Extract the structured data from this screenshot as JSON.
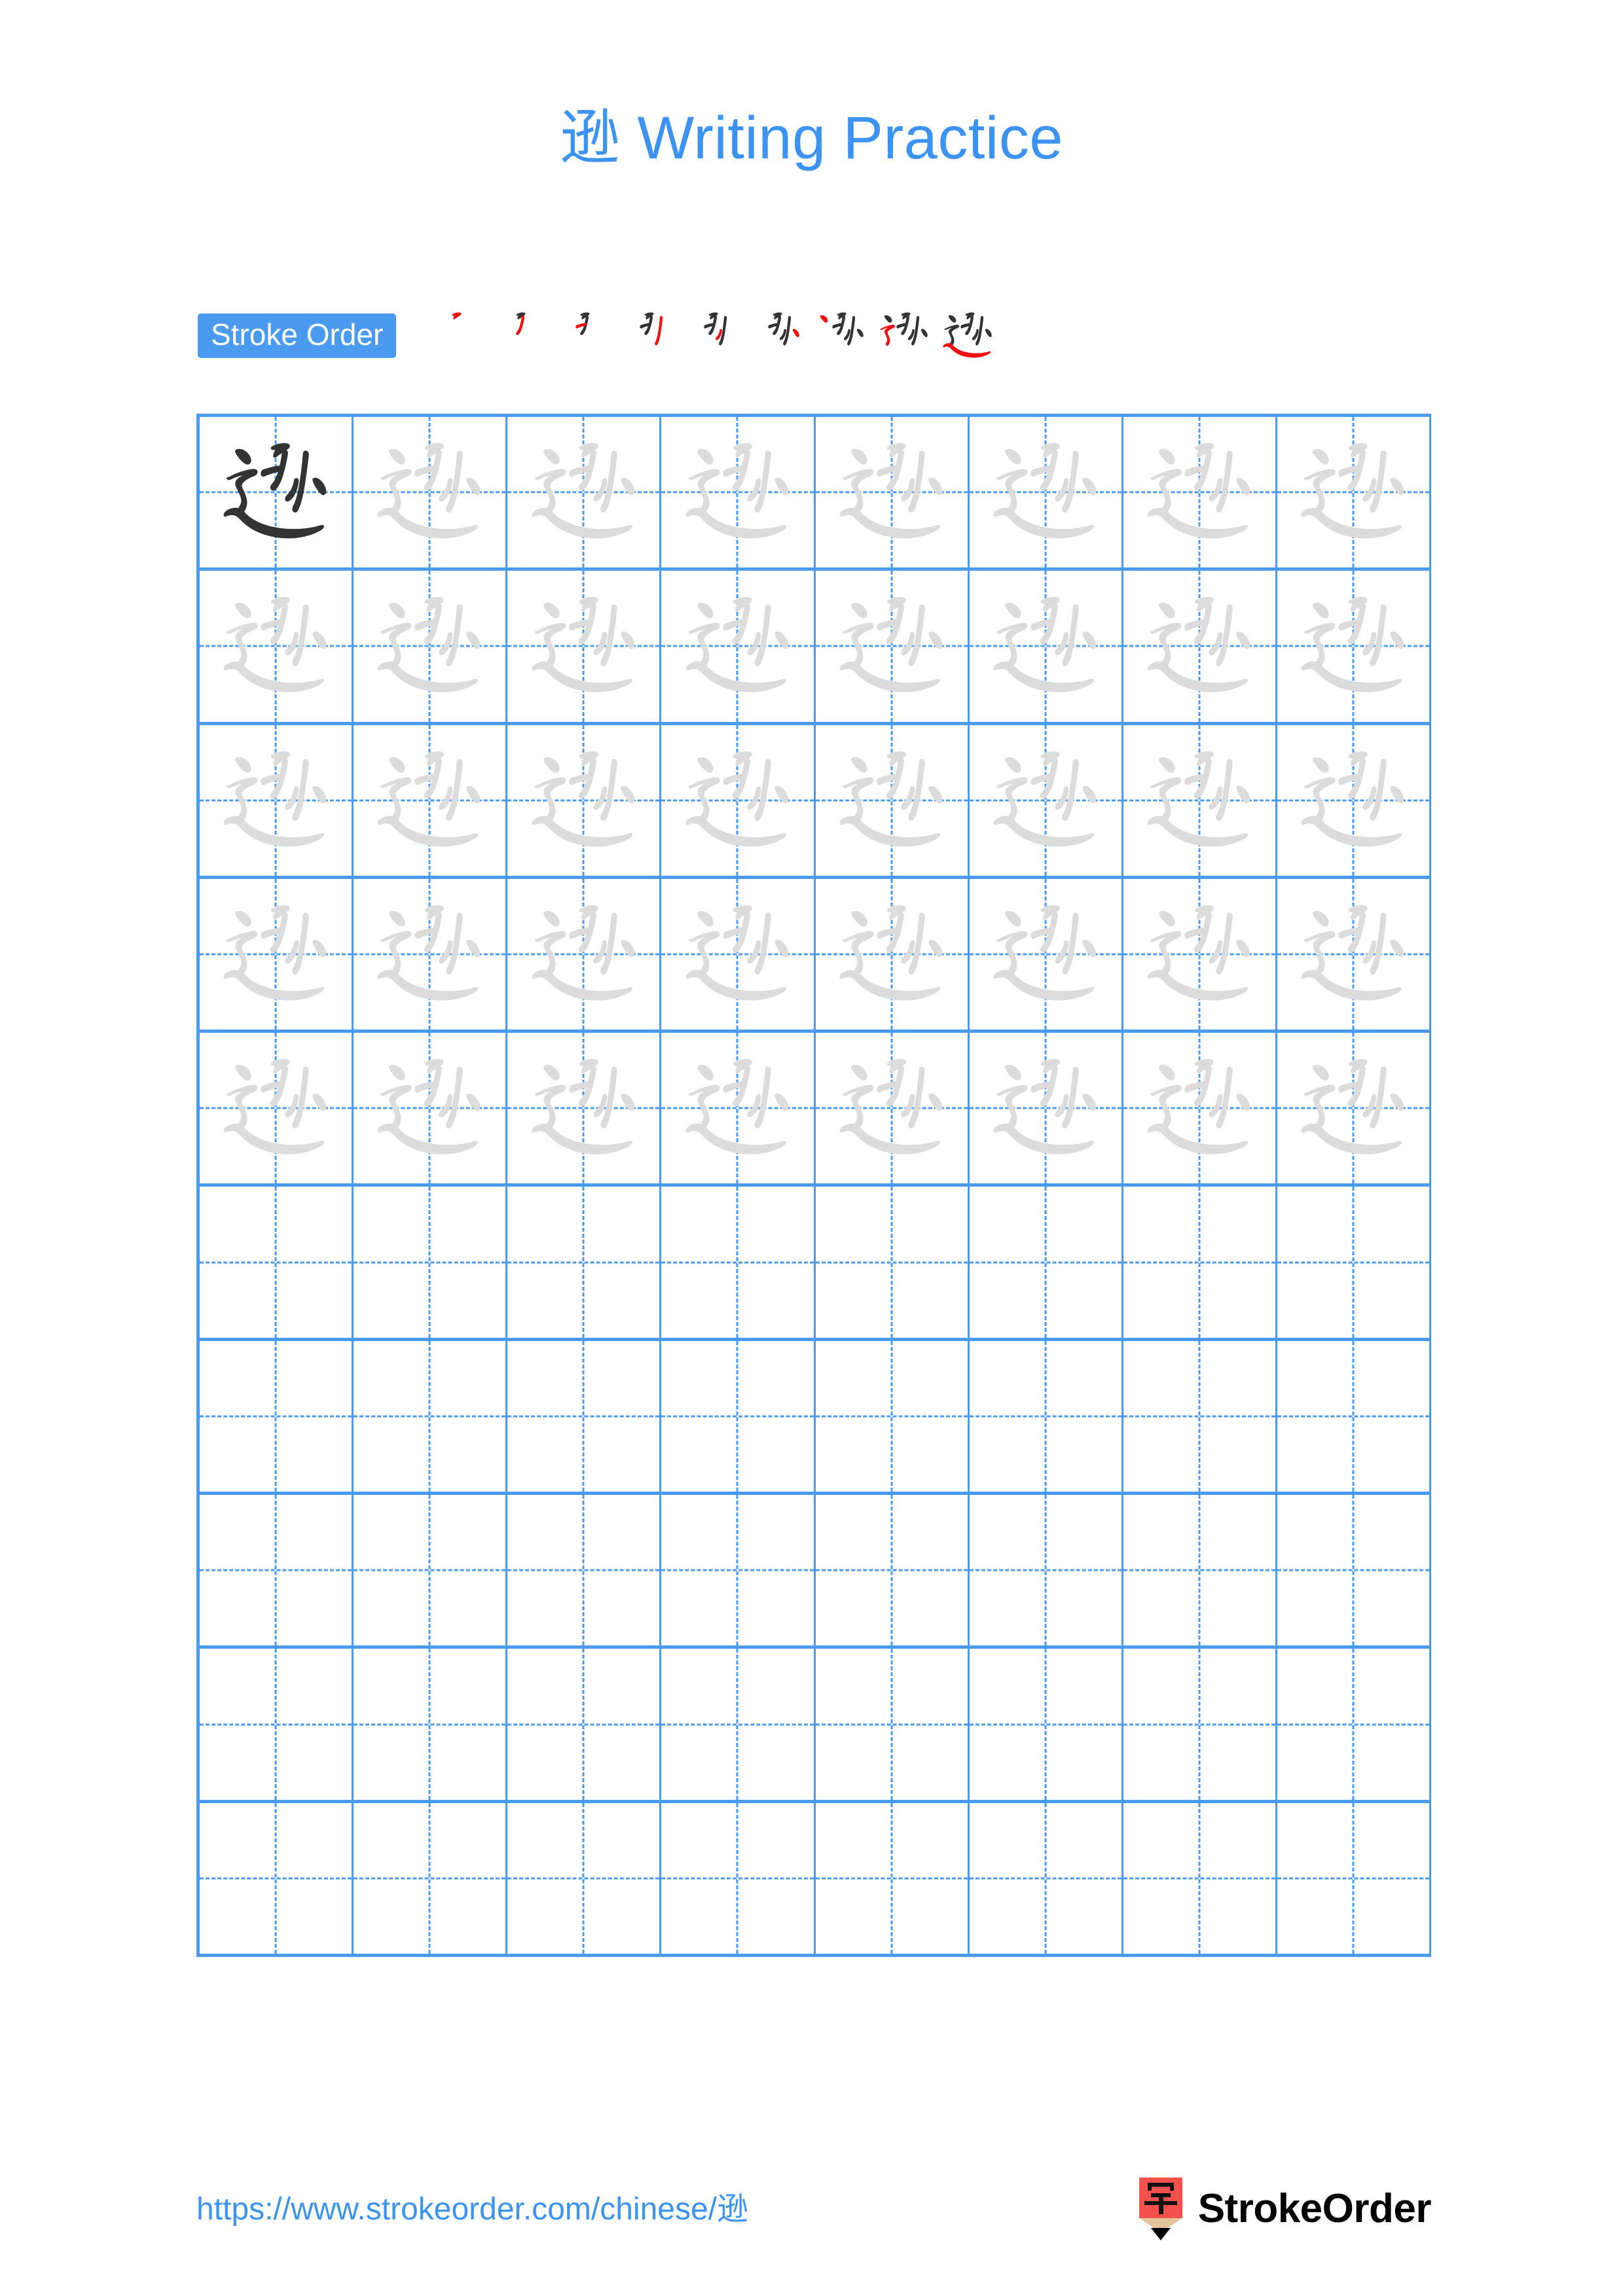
{
  "document": {
    "character": "逊",
    "title_suffix": " Writing Practice",
    "title_full": "逊 Writing Practice"
  },
  "colors": {
    "accent_blue": "#3d93f0",
    "badge_blue": "#4a9bf0",
    "grid_line": "#4a9bf0",
    "trace_gray": "#dcdcdc",
    "model_black": "#333333",
    "new_stroke_red": "#ee1111",
    "logo_red": "#f4514e",
    "logo_wood": "#e3c39a"
  },
  "stroke_order": {
    "label": "Stroke Order",
    "total_strokes": 9,
    "steps": [
      {
        "index": 1,
        "strokes_drawn": 1,
        "new_stroke_name": "heng-pie"
      },
      {
        "index": 2,
        "strokes_drawn": 2,
        "new_stroke_name": "heng-pie-wan-gou"
      },
      {
        "index": 3,
        "strokes_drawn": 3,
        "new_stroke_name": "heng-ti"
      },
      {
        "index": 4,
        "strokes_drawn": 4,
        "new_stroke_name": "shu-gou"
      },
      {
        "index": 5,
        "strokes_drawn": 5,
        "new_stroke_name": "pie"
      },
      {
        "index": 6,
        "strokes_drawn": 6,
        "new_stroke_name": "dian"
      },
      {
        "index": 7,
        "strokes_drawn": 7,
        "new_stroke_name": "dian-upper"
      },
      {
        "index": 8,
        "strokes_drawn": 8,
        "new_stroke_name": "heng-zhe-zhe-pie"
      },
      {
        "index": 9,
        "strokes_drawn": 9,
        "new_stroke_name": "ping-na"
      }
    ]
  },
  "practice_grid": {
    "columns": 8,
    "rows": 10,
    "rows_data": [
      {
        "row": 1,
        "cells": [
          "model",
          "trace",
          "trace",
          "trace",
          "trace",
          "trace",
          "trace",
          "trace"
        ]
      },
      {
        "row": 2,
        "cells": [
          "trace",
          "trace",
          "trace",
          "trace",
          "trace",
          "trace",
          "trace",
          "trace"
        ]
      },
      {
        "row": 3,
        "cells": [
          "trace",
          "trace",
          "trace",
          "trace",
          "trace",
          "trace",
          "trace",
          "trace"
        ]
      },
      {
        "row": 4,
        "cells": [
          "trace",
          "trace",
          "trace",
          "trace",
          "trace",
          "trace",
          "trace",
          "trace"
        ]
      },
      {
        "row": 5,
        "cells": [
          "trace",
          "trace",
          "trace",
          "trace",
          "trace",
          "trace",
          "trace",
          "trace"
        ]
      },
      {
        "row": 6,
        "cells": [
          "empty",
          "empty",
          "empty",
          "empty",
          "empty",
          "empty",
          "empty",
          "empty"
        ]
      },
      {
        "row": 7,
        "cells": [
          "empty",
          "empty",
          "empty",
          "empty",
          "empty",
          "empty",
          "empty",
          "empty"
        ]
      },
      {
        "row": 8,
        "cells": [
          "empty",
          "empty",
          "empty",
          "empty",
          "empty",
          "empty",
          "empty",
          "empty"
        ]
      },
      {
        "row": 9,
        "cells": [
          "empty",
          "empty",
          "empty",
          "empty",
          "empty",
          "empty",
          "empty",
          "empty"
        ]
      },
      {
        "row": 10,
        "cells": [
          "empty",
          "empty",
          "empty",
          "empty",
          "empty",
          "empty",
          "empty",
          "empty"
        ]
      }
    ]
  },
  "footer": {
    "url": "https://www.strokeorder.com/chinese/逊",
    "brand_name": "StrokeOrder",
    "logo_character": "字"
  }
}
